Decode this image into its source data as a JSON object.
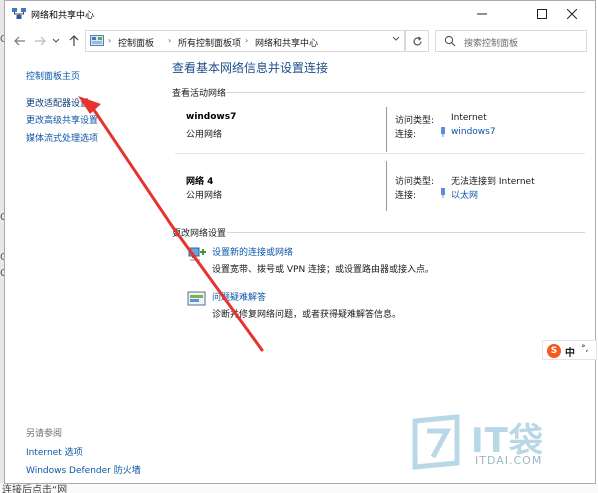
{
  "window": {
    "title": "网络和共享中心",
    "controls": [
      "minimize",
      "maximize",
      "close"
    ]
  },
  "address_bar": {
    "breadcrumbs": [
      "控制面板",
      "所有控制面板项",
      "网络和共享中心"
    ],
    "search_placeholder": "搜索控制面板"
  },
  "left_pane": {
    "links": [
      "控制面板主页",
      "更改适配器设置",
      "更改高级共享设置",
      "媒体流式处理选项"
    ],
    "see_also_label": "另请参阅",
    "see_also_links": [
      "Internet 选项",
      "Windows Defender 防火墙"
    ]
  },
  "main": {
    "title": "查看基本网络信息并设置连接",
    "active_networks_label": "查看活动网络",
    "networks": [
      {
        "name": "windows7",
        "type": "公用网络",
        "access_type_label": "访问类型:",
        "access_type": "Internet",
        "connection_label": "连接:",
        "connection": "windows7"
      },
      {
        "name": "网络 4",
        "type": "公用网络",
        "access_type_label": "访问类型:",
        "access_type": "无法连接到 Internet",
        "connection_label": "连接:",
        "connection": "以太网"
      }
    ],
    "change_settings_label": "更改网络设置",
    "tasks": [
      {
        "link": "设置新的连接或网络",
        "description": "设置宽带、拨号或 VPN 连接；或设置路由器或接入点。",
        "icon": "new-connection-icon"
      },
      {
        "link": "问题疑难解答",
        "description": "诊断并修复网络问题，或者获得疑难解答信息。",
        "icon": "troubleshoot-icon"
      }
    ]
  },
  "ime": {
    "logo": "S",
    "mode": "中",
    "punct": "°,"
  },
  "watermark": {
    "brand": "IT袋",
    "domain": "ITDAI.COM"
  },
  "background": {
    "bottom_text": "连接后点击“网",
    "left_glyphs": [
      "Q",
      "C",
      "Q",
      "C"
    ]
  },
  "colors": {
    "link": "#0c57a7",
    "title": "#1e4e8c",
    "arrow": "#e8322e"
  }
}
